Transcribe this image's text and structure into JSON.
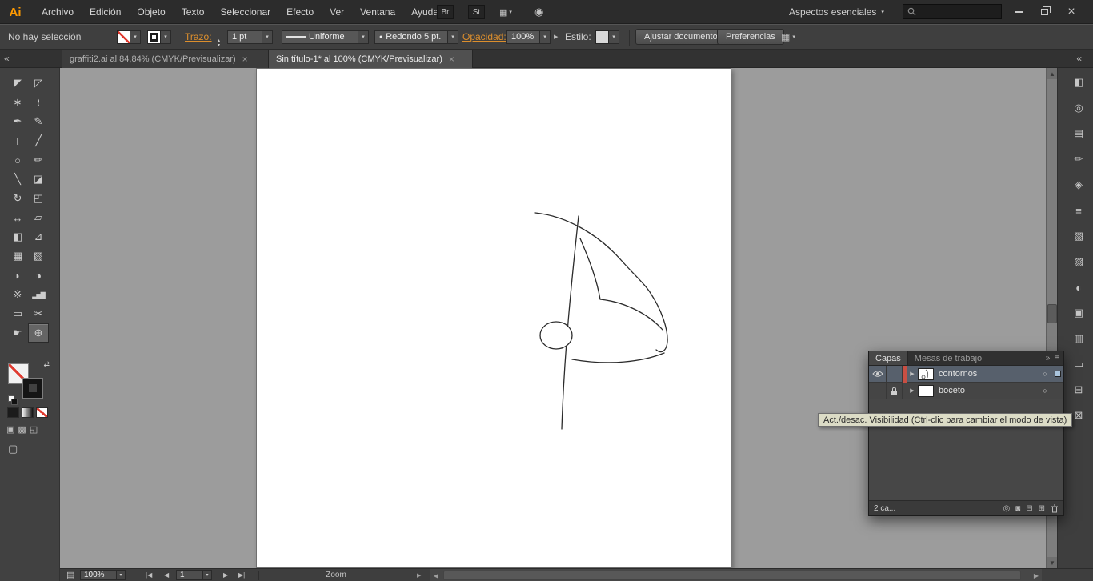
{
  "window": {
    "logo": "Ai"
  },
  "menubar": {
    "items": [
      "Archivo",
      "Edición",
      "Objeto",
      "Texto",
      "Seleccionar",
      "Efecto",
      "Ver",
      "Ventana",
      "Ayuda"
    ],
    "bridge_button": "Br",
    "stock_button": "St",
    "workspace_switcher": "Aspectos esenciales"
  },
  "controlbar": {
    "selection_status": "No hay selección",
    "stroke_label": "Trazo:",
    "stroke_value": "1 pt",
    "profile_value": "Uniforme",
    "brush_value": "Redondo 5 pt.",
    "opacity_label": "Opacidad:",
    "opacity_value": "100%",
    "style_label": "Estilo:",
    "fit_document_button": "Ajustar documento",
    "preferences_button": "Preferencias"
  },
  "tabs": {
    "tab1": "graffiti2.ai al 84,84% (CMYK/Previsualizar)",
    "tab2": "Sin título-1* al 100% (CMYK/Previsualizar)"
  },
  "tools": [
    {
      "name": "selection-tool",
      "glyph": "◤"
    },
    {
      "name": "direct-selection-tool",
      "glyph": "◸"
    },
    {
      "name": "magic-wand-tool",
      "glyph": "∗"
    },
    {
      "name": "lasso-tool",
      "glyph": "≀"
    },
    {
      "name": "pen-tool",
      "glyph": "✒"
    },
    {
      "name": "curvature-tool",
      "glyph": "✎"
    },
    {
      "name": "type-tool",
      "glyph": "T"
    },
    {
      "name": "line-segment-tool",
      "glyph": "╱"
    },
    {
      "name": "ellipse-tool",
      "glyph": "○"
    },
    {
      "name": "paintbrush-tool",
      "glyph": "✏"
    },
    {
      "name": "pencil-tool",
      "glyph": "╲"
    },
    {
      "name": "eraser-tool",
      "glyph": "◪"
    },
    {
      "name": "rotate-tool",
      "glyph": "↻"
    },
    {
      "name": "scale-tool",
      "glyph": "◰"
    },
    {
      "name": "width-tool",
      "glyph": "↔"
    },
    {
      "name": "free-transform-tool",
      "glyph": "▱"
    },
    {
      "name": "shape-builder-tool",
      "glyph": "◧"
    },
    {
      "name": "perspective-grid-tool",
      "glyph": "⊿"
    },
    {
      "name": "mesh-tool",
      "glyph": "▦"
    },
    {
      "name": "gradient-tool",
      "glyph": "▧"
    },
    {
      "name": "eyedropper-tool",
      "glyph": "◗"
    },
    {
      "name": "blend-tool",
      "glyph": "◑"
    },
    {
      "name": "symbol-sprayer-tool",
      "glyph": "※"
    },
    {
      "name": "column-graph-tool",
      "glyph": "▂▅▇"
    },
    {
      "name": "artboard-tool",
      "glyph": "▭"
    },
    {
      "name": "slice-tool",
      "glyph": "✂"
    },
    {
      "name": "hand-tool",
      "glyph": "☛"
    },
    {
      "name": "zoom-tool",
      "glyph": "⊕"
    }
  ],
  "dock": [
    {
      "name": "color-panel-icon",
      "glyph": "◧"
    },
    {
      "name": "color-guide-panel-icon",
      "glyph": "◎"
    },
    {
      "name": "swatches-panel-icon",
      "glyph": "▤"
    },
    {
      "name": "brushes-panel-icon",
      "glyph": "✏"
    },
    {
      "name": "symbols-panel-icon",
      "glyph": "◈"
    },
    {
      "name": "stroke-panel-icon",
      "glyph": "≡"
    },
    {
      "name": "gradient-panel-icon",
      "glyph": "▧"
    },
    {
      "name": "transparency-panel-icon",
      "glyph": "▨"
    },
    {
      "name": "appearance-panel-icon",
      "glyph": "◐"
    },
    {
      "name": "graphic-styles-panel-icon",
      "glyph": "▣"
    },
    {
      "name": "layers-panel-icon",
      "glyph": "▥"
    },
    {
      "name": "artboards-panel-icon",
      "glyph": "▭"
    },
    {
      "name": "align-panel-icon",
      "glyph": "⊟"
    },
    {
      "name": "pathfinder-panel-icon",
      "glyph": "⊠"
    }
  ],
  "layers_panel": {
    "tab_layers": "Capas",
    "tab_artboards": "Mesas de trabajo",
    "layers": [
      {
        "name": "contornos"
      },
      {
        "name": "boceto"
      }
    ],
    "footer_count": "2 ca..."
  },
  "tooltip": "Act./desac. Visibilidad (Ctrl-clic para cambiar el modo de vista)",
  "statusbar": {
    "zoom_value": "100%",
    "artboard_value": "1",
    "status_display": "Zoom"
  },
  "icons": {
    "caret": "▾",
    "spin_up": "▴",
    "spin_dn": "▾",
    "swap": "⇄",
    "expand_right": "▶",
    "tab_close": "×",
    "collapse_left": "«",
    "collapse_right": "»",
    "panel_menu": "≡",
    "arrange": "▦",
    "cslive": "◉",
    "brush_dot": "●",
    "disclosure": "▶",
    "target": "○",
    "nav_first": "|◀",
    "nav_prev": "◀",
    "nav_next": "▶",
    "nav_last": "▶|",
    "scroll_up": "▲",
    "scroll_down": "▼",
    "scroll_left": "◀",
    "scroll_right": "▶",
    "status_menu": "▤",
    "draw_normal": "▣",
    "draw_behind": "▩",
    "draw_inside": "◱",
    "screen_mode": "▢",
    "footer_locate": "◎",
    "footer_mask": "◙",
    "footer_sublayer": "⊟",
    "footer_new": "⊞"
  },
  "colors": {
    "selected_layer": "#57606c",
    "accent_orange": "#dd8f2d",
    "layer_color_bar": "#c94f43"
  }
}
